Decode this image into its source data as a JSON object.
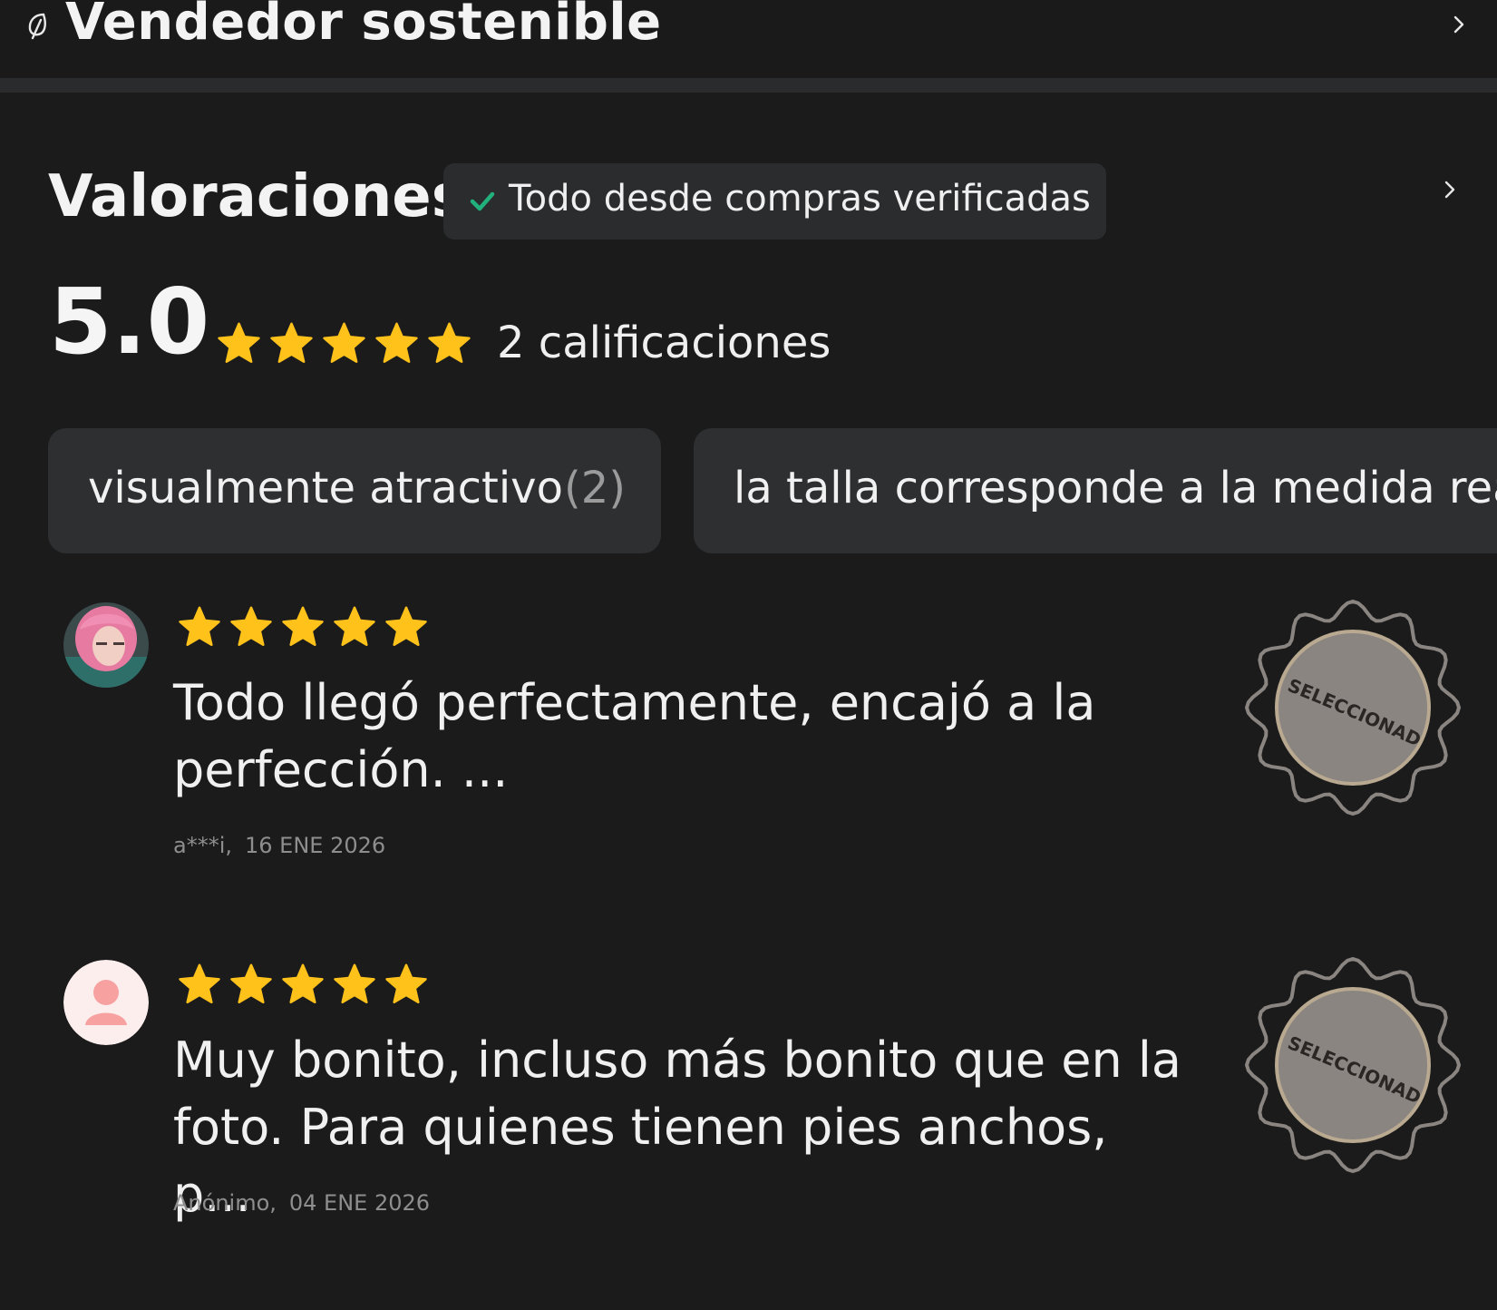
{
  "seller": {
    "title": "Vendedor sostenible",
    "icon": "leaf-icon"
  },
  "ratings": {
    "title": "Valoraciones",
    "verified_badge": "Todo desde compras verificadas",
    "score": "5.0",
    "stars": 5,
    "count_label": "2 calificaciones"
  },
  "tags": [
    {
      "label": "visualmente atractivo",
      "count": "(2)"
    },
    {
      "label": "la talla corresponde a la medida real"
    }
  ],
  "reviews": [
    {
      "stars": 5,
      "text": "Todo llegó perfectamente, encajó a la perfección. ...",
      "author": "a***i,",
      "date": "16 ENE 2026",
      "badge": "SELECCIONADO",
      "avatar": "user-photo"
    },
    {
      "stars": 5,
      "text": "Muy bonito, incluso más bonito que en la foto. Para quienes tienen pies anchos, p...",
      "author": "Anónimo,",
      "date": "04 ENE 2026",
      "badge": "SELECCIONADO",
      "avatar": "default-avatar"
    }
  ],
  "colors": {
    "background": "#1b1b1c",
    "star": "#ffc21a",
    "check": "#22b07d",
    "chip": "#2e2f31",
    "badge": "#8a8580"
  }
}
